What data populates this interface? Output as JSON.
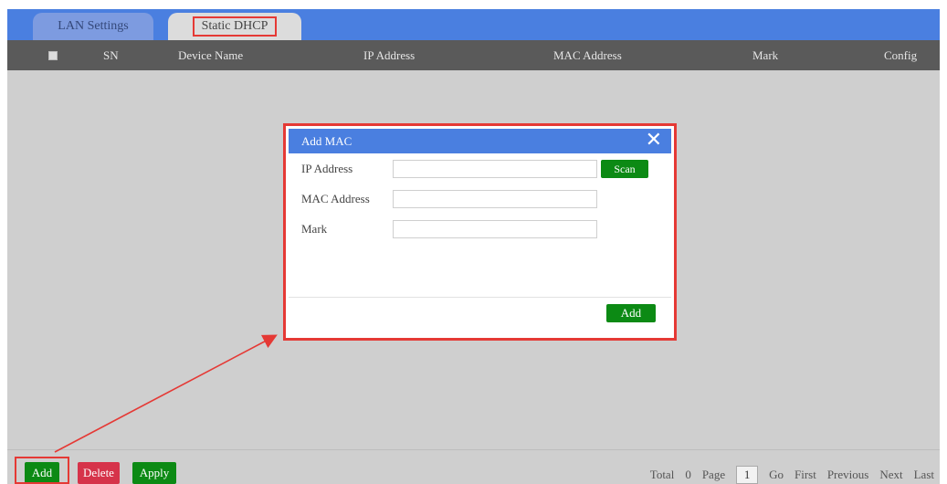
{
  "tabs": [
    {
      "label": "LAN Settings",
      "active": false
    },
    {
      "label": "Static DHCP",
      "active": true
    }
  ],
  "table": {
    "columns": [
      "SN",
      "Device Name",
      "IP Address",
      "MAC Address",
      "Mark",
      "Config"
    ]
  },
  "dialog": {
    "title": "Add MAC",
    "fields": {
      "ip_label": "IP Address",
      "mac_label": "MAC Address",
      "mark_label": "Mark",
      "ip_value": "",
      "mac_value": "",
      "mark_value": ""
    },
    "scan_label": "Scan",
    "add_label": "Add"
  },
  "footer": {
    "add_label": "Add",
    "delete_label": "Delete",
    "apply_label": "Apply"
  },
  "pager": {
    "total_label": "Total",
    "total_value": "0",
    "page_label": "Page",
    "page_value": "1",
    "go_label": "Go",
    "first_label": "First",
    "previous_label": "Previous",
    "next_label": "Next",
    "last_label": "Last"
  },
  "colors": {
    "accent": "#4a7fe0",
    "header": "#5a5a5a",
    "content_bg": "#cfcfcf",
    "success": "#0c8a14",
    "danger": "#d6334a",
    "annotation": "#e53935"
  }
}
